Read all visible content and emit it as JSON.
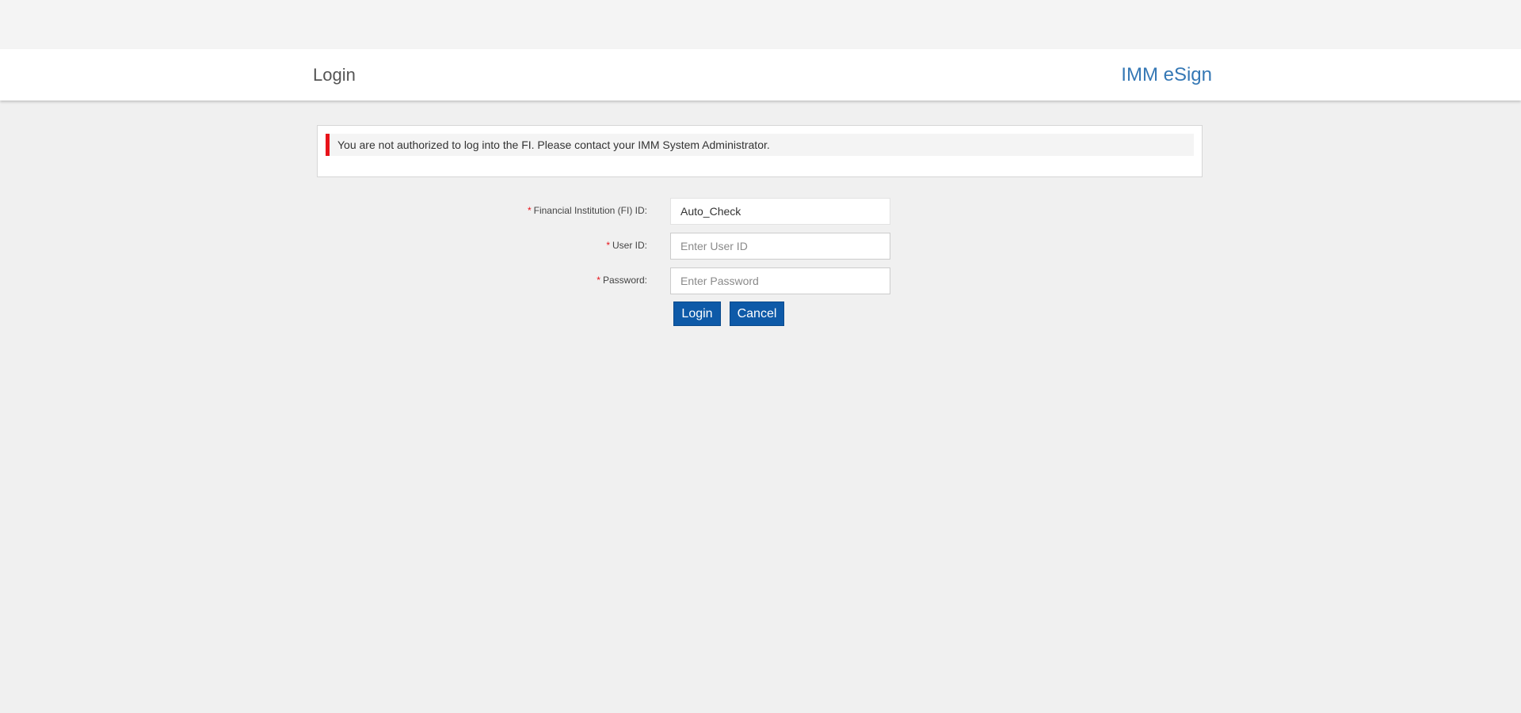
{
  "header": {
    "page_title": "Login",
    "brand": "IMM eSign"
  },
  "alert": {
    "message": "You are not authorized to log into the FI. Please contact your IMM System Administrator.",
    "bar_color": "#e8131a"
  },
  "form": {
    "required_marker": "*",
    "fi_id": {
      "label": "Financial Institution (FI) ID:",
      "value": "Auto_Check"
    },
    "user_id": {
      "label": "User ID:",
      "placeholder": "Enter User ID",
      "value": ""
    },
    "password": {
      "label": "Password:",
      "placeholder": "Enter Password",
      "value": ""
    }
  },
  "buttons": {
    "login_label": "Login",
    "cancel_label": "Cancel",
    "color": "#0e5aa8"
  },
  "colors": {
    "brand": "#3578b5",
    "required": "#e8131a",
    "background": "#f0f0f0"
  }
}
